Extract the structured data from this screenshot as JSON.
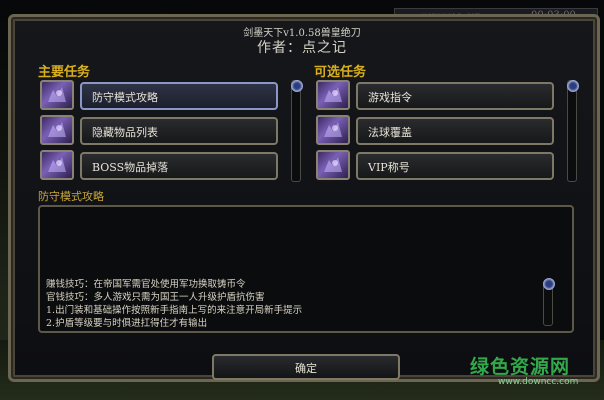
{
  "timer": {
    "label": "刷怪刷新时间",
    "time": "00:03:00"
  },
  "header": {
    "map_title": "剑墨天下v1.0.58兽皇绝刀",
    "author": "作者：点之记"
  },
  "main_tasks": {
    "heading": "主要任务",
    "items": [
      {
        "label": "防守模式攻略",
        "selected": true
      },
      {
        "label": "隐藏物品列表",
        "selected": false
      },
      {
        "label": "BOSS物品掉落",
        "selected": false
      }
    ]
  },
  "optional_tasks": {
    "heading": "可选任务",
    "items": [
      {
        "label": "游戏指令"
      },
      {
        "label": "法球覆盖"
      },
      {
        "label": "VIP称号"
      }
    ]
  },
  "description": {
    "title": "防守模式攻略",
    "lines": [
      "赚钱技巧：在帝国军需官处使用军功换取铸币令",
      "官钱技巧：多人游戏只需为国王一人升级护盾抗伤害",
      "1.出门装和基础操作按照新手指南上写的来注意开局新手提示",
      "2.护盾等级要与时俱进扛得住才有输出"
    ]
  },
  "confirm_button": "确定",
  "watermark": {
    "text": "绿色资源网",
    "url": "www.downcc.com"
  },
  "colors": {
    "heading": "#d9b01c",
    "panel_border": "#6b6552",
    "watermark": "#33a84a"
  }
}
